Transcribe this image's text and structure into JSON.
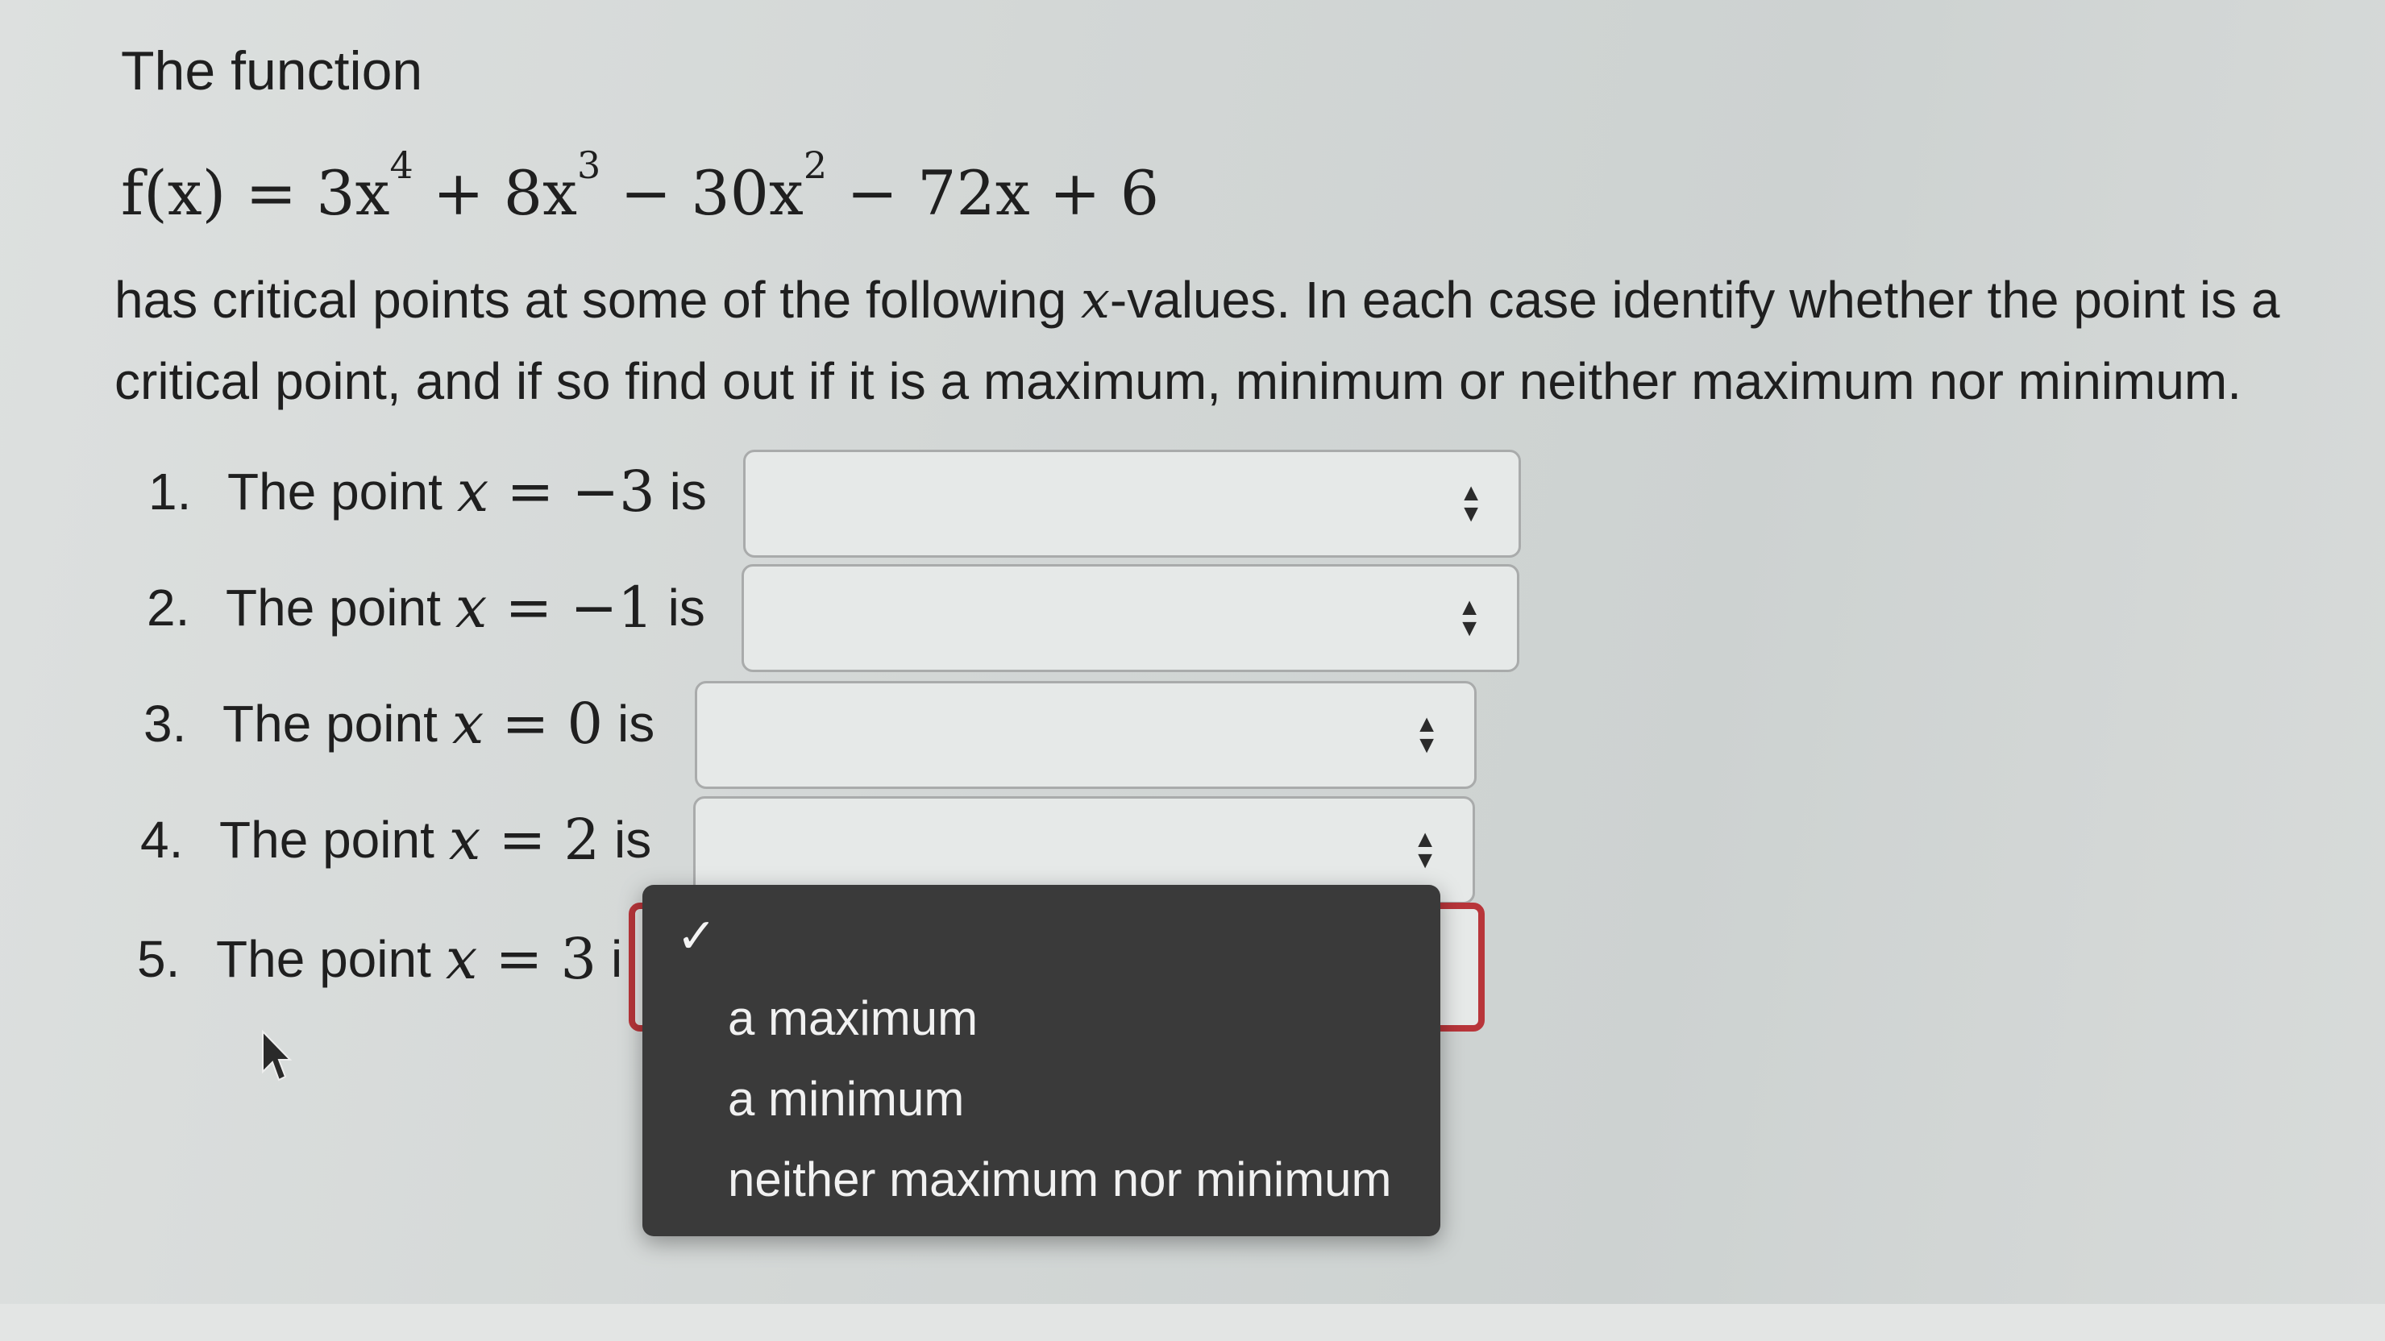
{
  "question": {
    "intro": "The function",
    "formula": {
      "lhs": "f(x) = 3x",
      "exp1": "4",
      "t2": " + 8x",
      "exp2": "3",
      "t3": " − 30x",
      "exp3": "2",
      "t4": " − 72x + 6"
    },
    "description_part1": "has critical points at some of the following ",
    "description_var": "x",
    "description_part2": "-values. In each case identify whether the point is a critical point, and if so find out if it is a maximum, minimum or neither maximum nor minimum."
  },
  "items": [
    {
      "number": "1.",
      "prefix": "The point",
      "var": "x",
      "equation": " = −3",
      "suffix": "is",
      "selected": ""
    },
    {
      "number": "2.",
      "prefix": "The point",
      "var": "x",
      "equation": " = −1",
      "suffix": "is",
      "selected": ""
    },
    {
      "number": "3.",
      "prefix": "The point",
      "var": "x",
      "equation": " = 0",
      "suffix": "is",
      "selected": ""
    },
    {
      "number": "4.",
      "prefix": "The point",
      "var": "x",
      "equation": " = 2",
      "suffix": "is",
      "selected": ""
    },
    {
      "number": "5.",
      "prefix": "The point",
      "var": "x",
      "equation": " = 3",
      "suffix": "i",
      "selected": ""
    }
  ],
  "dropdown": {
    "check_glyph": "✓",
    "options": [
      "a maximum",
      "a minimum",
      "neither maximum nor minimum"
    ]
  },
  "icons": {
    "select_arrows": "up-down-arrows-icon",
    "cursor": "mouse-pointer-icon",
    "check": "checkmark-icon"
  },
  "colors": {
    "focus_border": "#b8353a",
    "dropdown_bg": "#3a3a3a"
  }
}
